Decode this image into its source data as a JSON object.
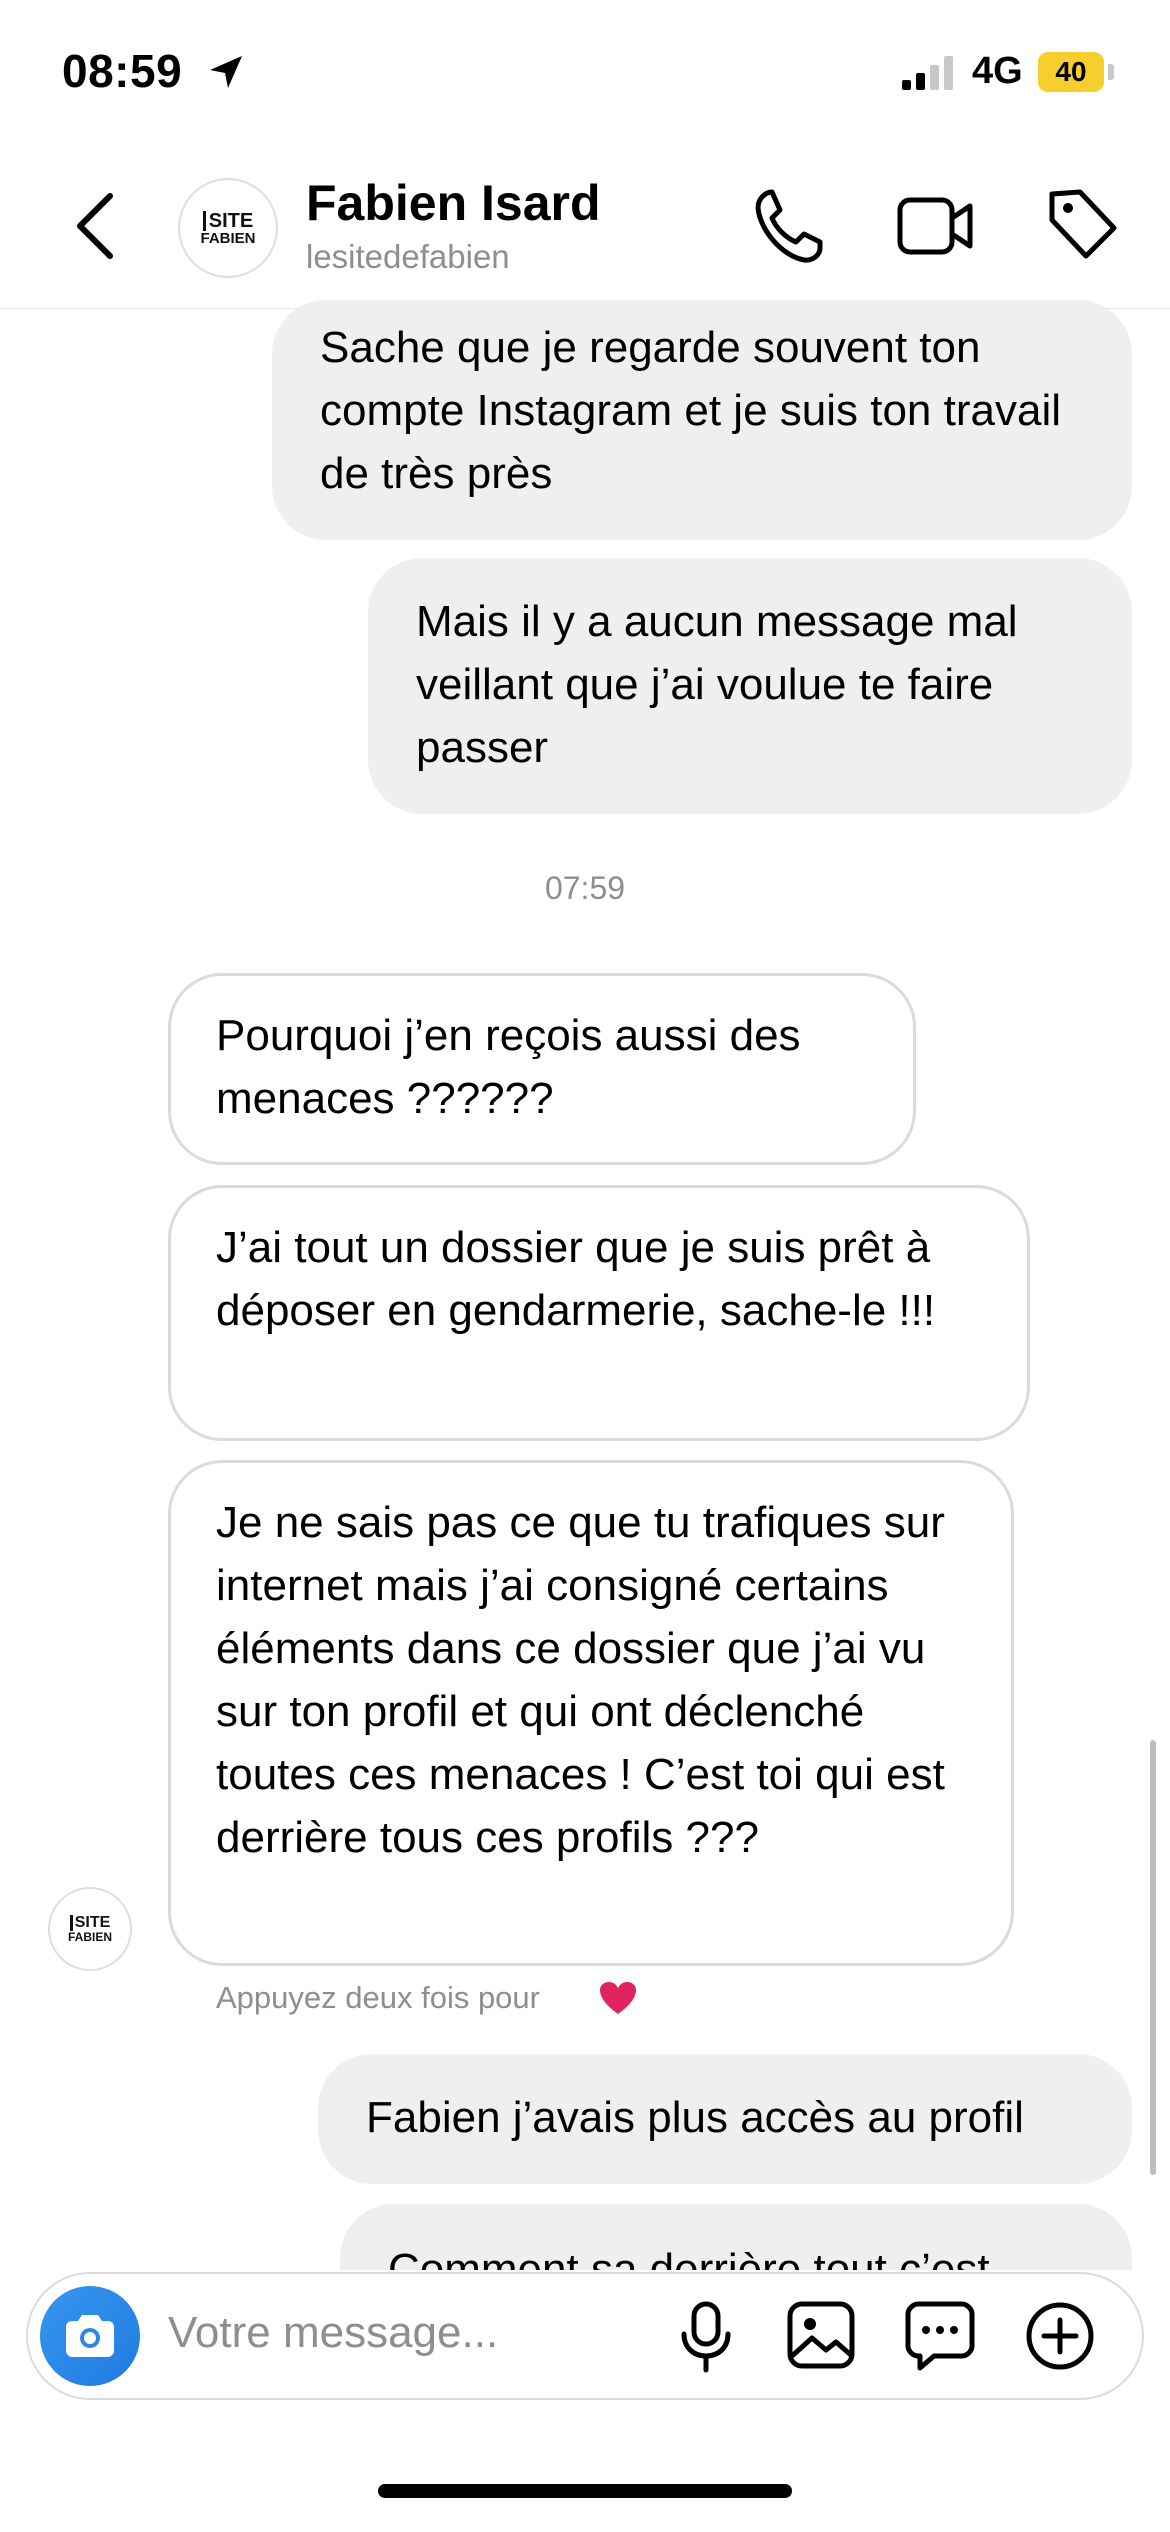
{
  "status_bar": {
    "time": "08:59",
    "network": "4G",
    "battery": "40",
    "battery_color": "#f6cf2f"
  },
  "header": {
    "name": "Fabien Isard",
    "username": "lesitedefabien",
    "avatar_logo_top": "SITE",
    "avatar_logo_bottom": "FABIEN",
    "icons": [
      "back-chevron-icon",
      "phone-icon",
      "video-camera-icon",
      "tag-icon"
    ]
  },
  "messages": [
    {
      "direction": "out",
      "text": "Sache que je regarde souvent ton compte Instagram et je suis ton travail de très près"
    },
    {
      "direction": "out",
      "text": "Mais il y a aucun message mal veillant que j’ai voulue te faire passer"
    },
    {
      "type": "timestamp",
      "text": "07:59"
    },
    {
      "direction": "in",
      "text": "Pourquoi j’en reçois aussi des menaces ??????"
    },
    {
      "direction": "in",
      "text": "J’ai tout un dossier que je suis prêt à déposer en gendarmerie, sache-le !!!"
    },
    {
      "direction": "in",
      "text": "Je ne sais pas ce que tu  trafiques sur internet mais j’ai consigné certains éléments dans ce dossier que j’ai vu sur ton profil et qui ont déclenché toutes ces menaces ! C’est toi qui est derrière tous ces profils ???"
    },
    {
      "direction": "out",
      "text": "Fabien j’avais plus accès au profil"
    },
    {
      "direction": "out",
      "text": "Comment sa derrière tout c’est"
    }
  ],
  "hint": {
    "text": "Appuyez deux fois pour",
    "icon": "heart-icon",
    "heart_color": "#e0245e"
  },
  "composer": {
    "placeholder": "Votre message...",
    "icons": [
      "camera-icon",
      "microphone-icon",
      "gallery-icon",
      "sticker-chat-icon",
      "plus-circle-icon"
    ],
    "accent": "#3797f0"
  }
}
